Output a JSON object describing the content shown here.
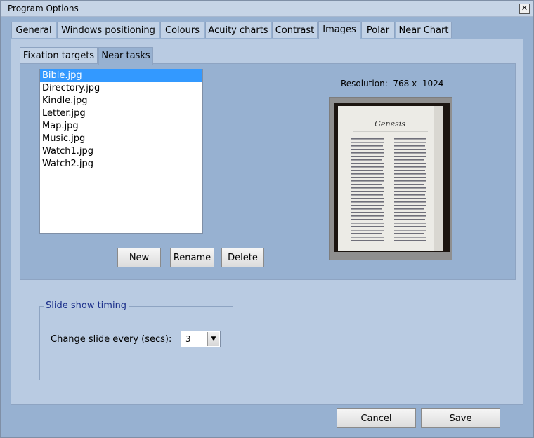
{
  "window": {
    "title": "Program Options",
    "close": "✕"
  },
  "tabs": [
    {
      "label": "General"
    },
    {
      "label": "Windows positioning"
    },
    {
      "label": "Colours"
    },
    {
      "label": "Acuity charts"
    },
    {
      "label": "Contrast"
    },
    {
      "label": "Images",
      "active": true
    },
    {
      "label": "Polar"
    },
    {
      "label": "Near Chart"
    }
  ],
  "subtabs": [
    {
      "label": "Fixation targets"
    },
    {
      "label": "Near tasks",
      "active": true
    }
  ],
  "files": [
    "Bible.jpg",
    "Directory.jpg",
    "Kindle.jpg",
    "Letter.jpg",
    "Map.jpg",
    "Music.jpg",
    "Watch1.jpg",
    "Watch2.jpg"
  ],
  "selected_file": "Bible.jpg",
  "resolution": {
    "label": "Resolution:",
    "width": "768",
    "sep": "x",
    "height": "1024"
  },
  "preview": {
    "heading": "Genesis"
  },
  "list_buttons": {
    "new": "New",
    "rename": "Rename",
    "delete": "Delete"
  },
  "slideshow": {
    "legend": "Slide show timing",
    "label": "Change slide every (secs):",
    "value": "3"
  },
  "footer": {
    "cancel": "Cancel",
    "save": "Save"
  },
  "colors": {
    "selection": "#3399ff",
    "panel": "#b9cbe2",
    "background": "#97b1d1",
    "legend_text": "#1b2f8a"
  },
  "icons": {
    "close": "close-icon",
    "dropdown": "chevron-down-icon"
  }
}
